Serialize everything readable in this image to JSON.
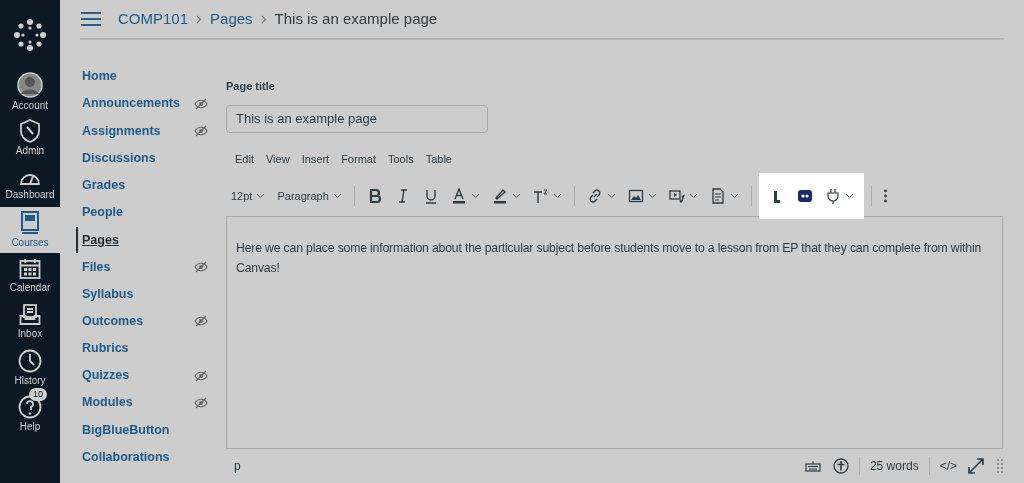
{
  "global_nav": [
    {
      "label": "Account",
      "selected": false
    },
    {
      "label": "Admin",
      "selected": false
    },
    {
      "label": "Dashboard",
      "selected": false
    },
    {
      "label": "Courses",
      "selected": true
    },
    {
      "label": "Calendar",
      "selected": false
    },
    {
      "label": "Inbox",
      "selected": false
    },
    {
      "label": "History",
      "selected": false
    },
    {
      "label": "Help",
      "selected": false,
      "badge": "10"
    }
  ],
  "breadcrumb": [
    "COMP101",
    "Pages",
    "This is an example page"
  ],
  "course_nav": [
    {
      "label": "Home",
      "selected": false,
      "hidden": false
    },
    {
      "label": "Announcements",
      "selected": false,
      "hidden": true
    },
    {
      "label": "Assignments",
      "selected": false,
      "hidden": true
    },
    {
      "label": "Discussions",
      "selected": false,
      "hidden": false
    },
    {
      "label": "Grades",
      "selected": false,
      "hidden": false
    },
    {
      "label": "People",
      "selected": false,
      "hidden": false
    },
    {
      "label": "Pages",
      "selected": true,
      "hidden": false
    },
    {
      "label": "Files",
      "selected": false,
      "hidden": true
    },
    {
      "label": "Syllabus",
      "selected": false,
      "hidden": false
    },
    {
      "label": "Outcomes",
      "selected": false,
      "hidden": true
    },
    {
      "label": "Rubrics",
      "selected": false,
      "hidden": false
    },
    {
      "label": "Quizzes",
      "selected": false,
      "hidden": true
    },
    {
      "label": "Modules",
      "selected": false,
      "hidden": true
    },
    {
      "label": "BigBlueButton",
      "selected": false,
      "hidden": false
    },
    {
      "label": "Collaborations",
      "selected": false,
      "hidden": false
    }
  ],
  "page_title": {
    "label": "Page title",
    "value": "This is an example page"
  },
  "editor": {
    "menus": [
      "Edit",
      "View",
      "Insert",
      "Format",
      "Tools",
      "Table"
    ],
    "toolbar_groups": [
      {
        "highlighted": false,
        "items": [
          {
            "kind": "text",
            "label": "12pt",
            "caret": true
          },
          {
            "kind": "text",
            "label": "Paragraph",
            "caret": true
          }
        ]
      },
      {
        "highlighted": false,
        "items": [
          {
            "kind": "icon",
            "caret": false
          },
          {
            "kind": "icon",
            "caret": false
          },
          {
            "kind": "icon",
            "caret": false
          },
          {
            "kind": "icon",
            "caret": true
          },
          {
            "kind": "icon",
            "caret": true
          },
          {
            "kind": "icon",
            "caret": true
          }
        ]
      },
      {
        "highlighted": false,
        "items": [
          {
            "kind": "icon",
            "caret": true
          },
          {
            "kind": "icon",
            "caret": true
          },
          {
            "kind": "icon",
            "caret": true
          },
          {
            "kind": "icon",
            "caret": true
          }
        ]
      },
      {
        "highlighted": true,
        "items": [
          {
            "kind": "icon",
            "caret": false
          },
          {
            "kind": "icon",
            "caret": false
          },
          {
            "kind": "icon",
            "caret": true
          }
        ]
      },
      {
        "highlighted": false,
        "items": [
          {
            "kind": "icon",
            "caret": false
          }
        ]
      }
    ],
    "content": "Here we can place some information about the particular subject before students move to a lesson from EP that they can complete from within Canvas!",
    "status_path": "p",
    "word_count": "25 words",
    "html_toggle": "</>"
  }
}
